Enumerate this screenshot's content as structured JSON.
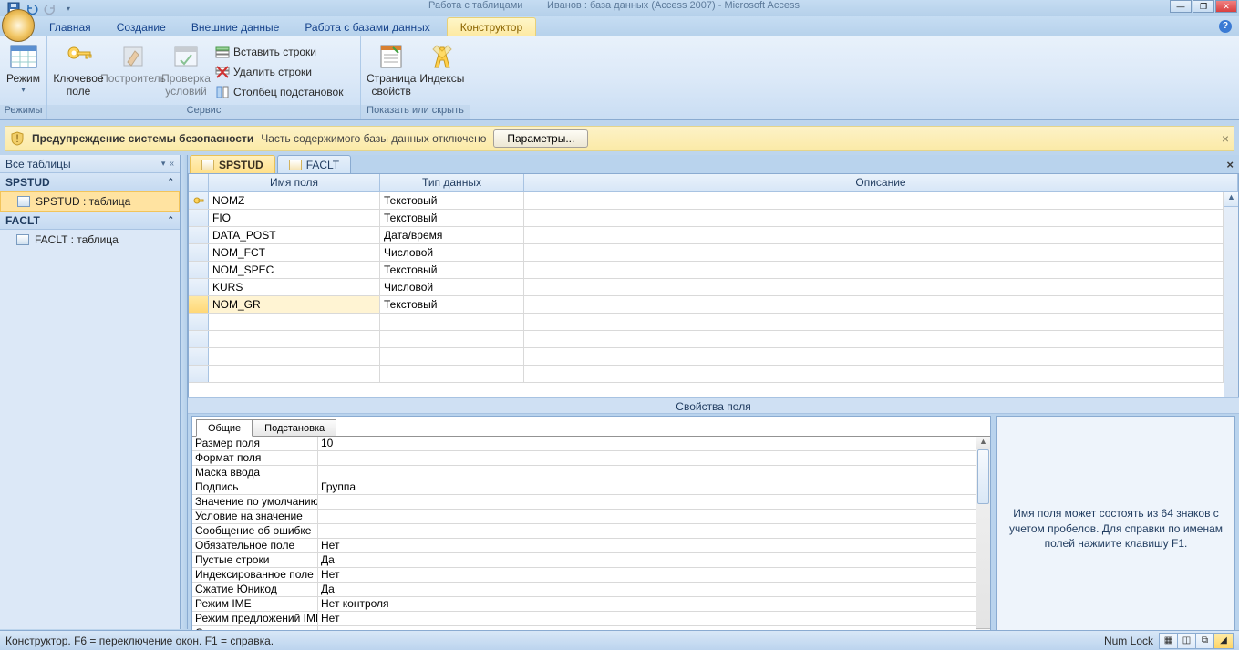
{
  "title": {
    "context_group": "Работа с таблицами",
    "app": "Иванов : база данных (Access 2007) - Microsoft Access"
  },
  "tabs": {
    "home": "Главная",
    "create": "Создание",
    "external": "Внешние данные",
    "dbtools": "Работа с базами данных",
    "designer": "Конструктор"
  },
  "ribbon": {
    "group_modes": "Режимы",
    "group_service": "Сервис",
    "group_showhide": "Показать или скрыть",
    "btn_mode": "Режим",
    "btn_key": "Ключевое поле",
    "btn_builder": "Построитель",
    "btn_validate": "Проверка условий",
    "btn_insert_rows": "Вставить строки",
    "btn_delete_rows": "Удалить строки",
    "btn_lookup_col": "Столбец  подстановок",
    "btn_propsheet": "Страница свойств",
    "btn_indexes": "Индексы"
  },
  "security": {
    "title": "Предупреждение системы безопасности",
    "msg": "Часть содержимого базы данных отключено",
    "button": "Параметры..."
  },
  "nav": {
    "header": "Все таблицы",
    "groups": [
      {
        "name": "SPSTUD",
        "items": [
          "SPSTUD : таблица"
        ],
        "selected": 0
      },
      {
        "name": "FACLT",
        "items": [
          "FACLT : таблица"
        ]
      }
    ]
  },
  "doc_tabs": [
    {
      "label": "SPSTUD",
      "active": true
    },
    {
      "label": "FACLT",
      "active": false
    }
  ],
  "design": {
    "headers": {
      "name": "Имя поля",
      "type": "Тип данных",
      "desc": "Описание"
    },
    "rows": [
      {
        "name": "NOMZ",
        "type": "Текстовый",
        "pk": true
      },
      {
        "name": "FIO",
        "type": "Текстовый"
      },
      {
        "name": "DATA_POST",
        "type": "Дата/время"
      },
      {
        "name": "NOM_FCT",
        "type": "Числовой"
      },
      {
        "name": "NOM_SPEC",
        "type": "Текстовый"
      },
      {
        "name": "KURS",
        "type": "Числовой"
      },
      {
        "name": "NOM_GR",
        "type": "Текстовый",
        "selected": true
      }
    ],
    "blank_rows": 4
  },
  "props": {
    "section_title": "Свойства поля",
    "tab_general": "Общие",
    "tab_lookup": "Подстановка",
    "help": "Имя поля может состоять из 64 знаков с учетом пробелов.  Для справки по именам полей нажмите клавишу F1.",
    "rows": [
      {
        "k": "Размер поля",
        "v": "10"
      },
      {
        "k": "Формат поля",
        "v": ""
      },
      {
        "k": "Маска ввода",
        "v": ""
      },
      {
        "k": "Подпись",
        "v": "Группа"
      },
      {
        "k": "Значение по умолчанию",
        "v": ""
      },
      {
        "k": "Условие на значение",
        "v": ""
      },
      {
        "k": "Сообщение об ошибке",
        "v": ""
      },
      {
        "k": "Обязательное поле",
        "v": "Нет"
      },
      {
        "k": "Пустые строки",
        "v": "Да"
      },
      {
        "k": "Индексированное поле",
        "v": "Нет"
      },
      {
        "k": "Сжатие Юникод",
        "v": "Да"
      },
      {
        "k": "Режим IME",
        "v": "Нет контроля"
      },
      {
        "k": "Режим предложений IME",
        "v": "Нет"
      },
      {
        "k": "Смарт-теги",
        "v": ""
      }
    ]
  },
  "status": {
    "left": "Конструктор.  F6 = переключение окон.  F1 = справка.",
    "numlock": "Num Lock"
  }
}
